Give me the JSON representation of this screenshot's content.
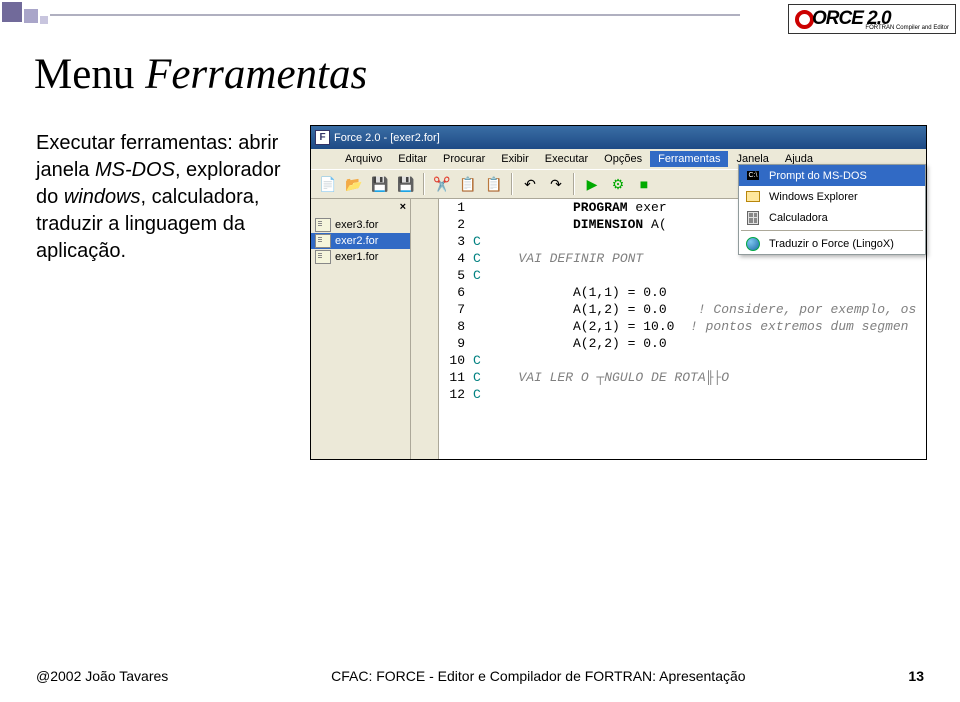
{
  "slide": {
    "title_normal": "Menu ",
    "title_italic": "Ferramentas",
    "body_line1": "Executar ferramentas: abrir janela ",
    "body_ms": "MS-DOS",
    "body_line2": ", explorador do ",
    "body_win": "windows",
    "body_line3": ", calculadora, traduzir a linguagem da aplicação."
  },
  "logo": {
    "text": "ORCE 2.0",
    "tag": "FORTRAN Compiler and Editor"
  },
  "app": {
    "title": "Force 2.0 - [exer2.for]",
    "menu": [
      "Arquivo",
      "Editar",
      "Procurar",
      "Exibir",
      "Executar",
      "Opções",
      "Ferramentas",
      "Janela",
      "Ajuda"
    ],
    "sidefiles": [
      "exer3.for",
      "exer2.for",
      "exer1.for"
    ],
    "dropdown": [
      {
        "label": "Prompt do MS-DOS",
        "icon": "dos"
      },
      {
        "label": "Windows Explorer",
        "icon": "explorer"
      },
      {
        "label": "Calculadora",
        "icon": "calc"
      },
      {
        "label": "Traduzir o Force (LingoX)",
        "icon": "globe"
      }
    ],
    "code": [
      {
        "n": "1",
        "col": "",
        "text": "PROGRAM exer",
        "kw": true
      },
      {
        "n": "2",
        "col": "",
        "text": "DIMENSION A(",
        "kw": true
      },
      {
        "n": "3",
        "col": "C",
        "text": ""
      },
      {
        "n": "4",
        "col": "C",
        "text": "   VAI DEFINIR PONT",
        "cmt": true
      },
      {
        "n": "5",
        "col": "C",
        "text": ""
      },
      {
        "n": "6",
        "col": "",
        "text": "A(1,1) = 0.0"
      },
      {
        "n": "7",
        "col": "",
        "text": "A(1,2) = 0.0    ",
        "tail": "! Considere, por exemplo, os"
      },
      {
        "n": "8",
        "col": "",
        "text": "A(2,1) = 10.0  ",
        "tail": "! pontos extremos dum segmen"
      },
      {
        "n": "9",
        "col": "",
        "text": "A(2,2) = 0.0"
      },
      {
        "n": "10",
        "col": "C",
        "text": ""
      },
      {
        "n": "11",
        "col": "C",
        "text": "   VAI LER O ┬NGULO DE ROTA╟├O",
        "cmt": true
      },
      {
        "n": "12",
        "col": "C",
        "text": ""
      }
    ]
  },
  "footer": {
    "left": "@2002 João Tavares",
    "center": "CFAC: FORCE - Editor e Compilador de FORTRAN: Apresentação",
    "right": "13"
  }
}
